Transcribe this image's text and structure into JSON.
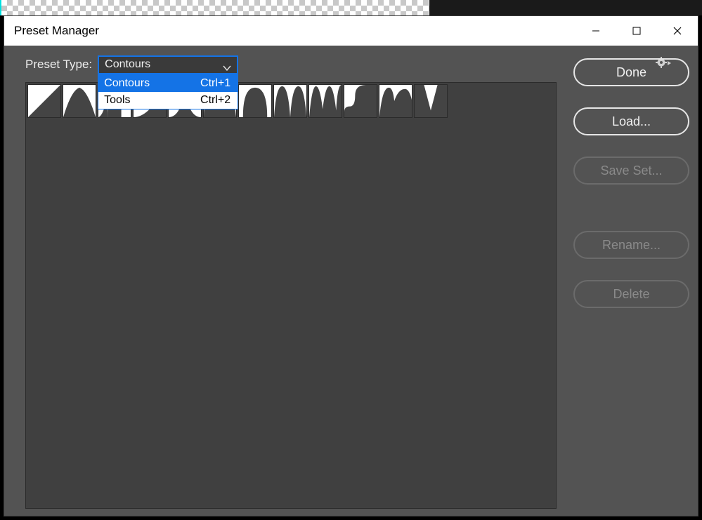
{
  "window": {
    "title": "Preset Manager"
  },
  "controls": {
    "minimize": "minimize",
    "maximize": "maximize",
    "close": "close"
  },
  "form": {
    "type_label": "Preset Type:",
    "type_selected": "Contours"
  },
  "dropdown": {
    "options": [
      {
        "label": "Contours",
        "shortcut": "Ctrl+1",
        "selected": true
      },
      {
        "label": "Tools",
        "shortcut": "Ctrl+2",
        "selected": false
      }
    ]
  },
  "buttons": {
    "done": "Done",
    "load": "Load...",
    "saveset": "Save Set...",
    "rename": "Rename...",
    "delete": "Delete"
  },
  "contour_thumbs": [
    "linear",
    "cone",
    "cove-deep",
    "cove-shallow",
    "gaussian",
    "half-round",
    "ring",
    "ring-double",
    "rolling",
    "rounded-steps",
    "sawtooth",
    "valley"
  ]
}
